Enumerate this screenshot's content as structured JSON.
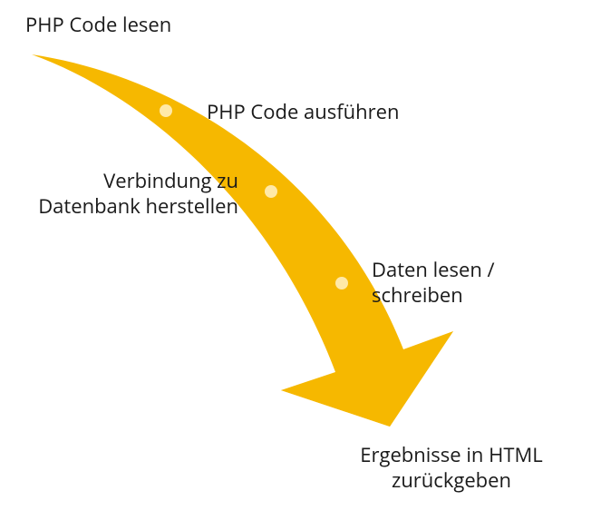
{
  "diagram": {
    "arrow_color": "#F6B800",
    "dot_color": "#FFE9A8",
    "steps": [
      {
        "key": "read_code",
        "text": "PHP Code lesen"
      },
      {
        "key": "exec_code",
        "text": "PHP Code ausführen"
      },
      {
        "key": "db_connect",
        "text": "Verbindung zu\nDatenbank herstellen"
      },
      {
        "key": "data_rw",
        "text": "Daten lesen /\nschreiben"
      },
      {
        "key": "output_html",
        "text": "Ergebnisse in HTML\nzurückgeben"
      }
    ]
  }
}
